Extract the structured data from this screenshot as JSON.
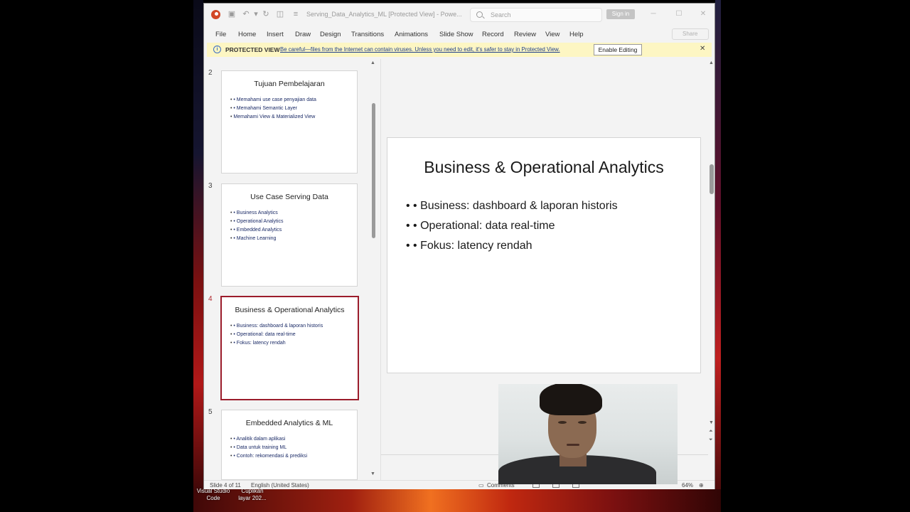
{
  "window": {
    "doc_title": "Serving_Data_Analytics_ML [Protected View] - Powe...",
    "search_placeholder": "Search",
    "sign_in_label": "Sign in",
    "share_label": "Share"
  },
  "menu": [
    "File",
    "Home",
    "Insert",
    "Draw",
    "Design",
    "Transitions",
    "Animations",
    "Slide Show",
    "Record",
    "Review",
    "View",
    "Help"
  ],
  "protected_view": {
    "label": "PROTECTED VIEW",
    "message": "Be careful—files from the Internet can contain viruses. Unless you need to edit, it's safer to stay in Protected View.",
    "enable_label": "Enable Editing",
    "close_icon": "close-icon"
  },
  "thumbnails": [
    {
      "number": "2",
      "title": "Tujuan Pembelajaran",
      "bullets": [
        "• Memahami use case penyajian data",
        "• Memahami Semantic Layer",
        "Memahami View & Materialized View"
      ]
    },
    {
      "number": "3",
      "title": "Use Case Serving Data",
      "bullets": [
        "• Business Analytics",
        "• Operational Analytics",
        "• Embedded Analytics",
        "• Machine Learning"
      ]
    },
    {
      "number": "4",
      "title": "Business & Operational Analytics",
      "bullets": [
        "• Business: dashboard & laporan historis",
        "• Operational: data real-time",
        "• Fokus: latency rendah"
      ]
    },
    {
      "number": "5",
      "title": "Embedded Analytics & ML",
      "bullets": [
        "• Analitik dalam aplikasi",
        "• Data untuk training ML",
        "• Contoh: rekomendasi & prediksi"
      ]
    }
  ],
  "current_slide": {
    "title": "Business & Operational Analytics",
    "bullets": [
      "• Business: dashboard & laporan historis",
      "• Operational: data real-time",
      "• Fokus: latency rendah"
    ]
  },
  "status": {
    "slide_counter": "Slide 4 of 11",
    "language": "English (United States)",
    "comments_label": "Comments",
    "zoom": "64%"
  },
  "desktop": {
    "vscode_label": "Visual Studio Code",
    "snip_label": "Cuplikan layar 202..."
  },
  "colors": {
    "accent": "#9b1c2b",
    "protected_bg": "#fdf6c3",
    "link": "#1f3f8a"
  }
}
